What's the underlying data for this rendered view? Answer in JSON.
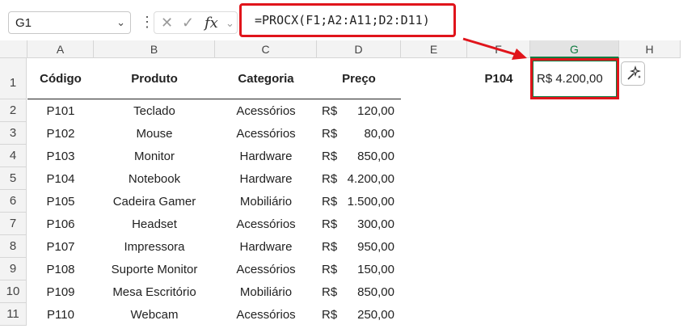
{
  "name_box": {
    "value": "G1"
  },
  "formula_bar": {
    "formula": "=PROCX(F1;A2:A11;D2:D11)",
    "fx_label": "fx"
  },
  "columns": [
    "A",
    "B",
    "C",
    "D",
    "E",
    "F",
    "G",
    "H"
  ],
  "rows": [
    "1",
    "2",
    "3",
    "4",
    "5",
    "6",
    "7",
    "8",
    "9",
    "10",
    "11"
  ],
  "headers": {
    "codigo": "Código",
    "produto": "Produto",
    "categoria": "Categoria",
    "preco": "Preço"
  },
  "lookup": {
    "key": "P104",
    "result": "R$ 4.200,00"
  },
  "currency_symbol": "R$",
  "data": [
    {
      "codigo": "P101",
      "produto": "Teclado",
      "categoria": "Acessórios",
      "preco": "120,00"
    },
    {
      "codigo": "P102",
      "produto": "Mouse",
      "categoria": "Acessórios",
      "preco": "80,00"
    },
    {
      "codigo": "P103",
      "produto": "Monitor",
      "categoria": "Hardware",
      "preco": "850,00"
    },
    {
      "codigo": "P104",
      "produto": "Notebook",
      "categoria": "Hardware",
      "preco": "4.200,00"
    },
    {
      "codigo": "P105",
      "produto": "Cadeira Gamer",
      "categoria": "Mobiliário",
      "preco": "1.500,00"
    },
    {
      "codigo": "P106",
      "produto": "Headset",
      "categoria": "Acessórios",
      "preco": "300,00"
    },
    {
      "codigo": "P107",
      "produto": "Impressora",
      "categoria": "Hardware",
      "preco": "950,00"
    },
    {
      "codigo": "P108",
      "produto": "Suporte Monitor",
      "categoria": "Acessórios",
      "preco": "150,00"
    },
    {
      "codigo": "P109",
      "produto": "Mesa Escritório",
      "categoria": "Mobiliário",
      "preco": "850,00"
    },
    {
      "codigo": "P110",
      "produto": "Webcam",
      "categoria": "Acessórios",
      "preco": "250,00"
    }
  ],
  "colors": {
    "highlight": "#e0141b",
    "selection": "#107c41"
  },
  "icons": [
    "chevron-down-icon",
    "more-vert-icon",
    "cancel-icon",
    "check-icon",
    "function-icon",
    "sparkle-icon",
    "arrow-icon"
  ]
}
